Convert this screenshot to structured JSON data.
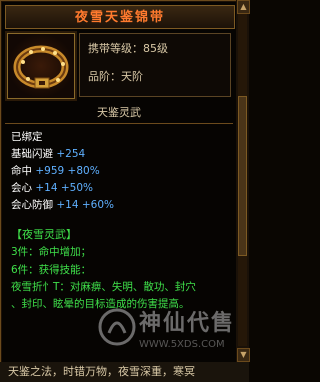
{
  "item": {
    "name": "夜雪天鉴锦带",
    "carry_level": "携带等级：85级",
    "grade": "品阶：天阶",
    "category": "天鉴灵武"
  },
  "status": {
    "bound": "已绑定"
  },
  "stats": [
    {
      "label": "基础闪避",
      "value": "+254",
      "pct": ""
    },
    {
      "label": "命中",
      "value": "+959",
      "pct": "+80%"
    },
    {
      "label": "会心",
      "value": "+14",
      "pct": "+50%"
    },
    {
      "label": "会心防御",
      "value": "+14",
      "pct": "+60%"
    }
  ],
  "set": {
    "name": "【夜雪灵武】",
    "bonus_3": "3件：命中增加；",
    "bonus_6": "6件：获得技能：",
    "desc_line1": "夜雪折忄T：对麻痹、失明、散功、封穴",
    "desc_line2": "、封印、眩晕的目标造成的伤害提高。"
  },
  "background_text": "天鉴之法，时错万物，夜雪深重，寒冥",
  "watermark": {
    "chars": "神仙代售",
    "url": "WWW.5XDS.COM"
  },
  "colors": {
    "title": "#ff7a2e",
    "set_green": "#3fe04a",
    "stat_blue": "#5fb0ff",
    "border": "#6b4a1c"
  }
}
